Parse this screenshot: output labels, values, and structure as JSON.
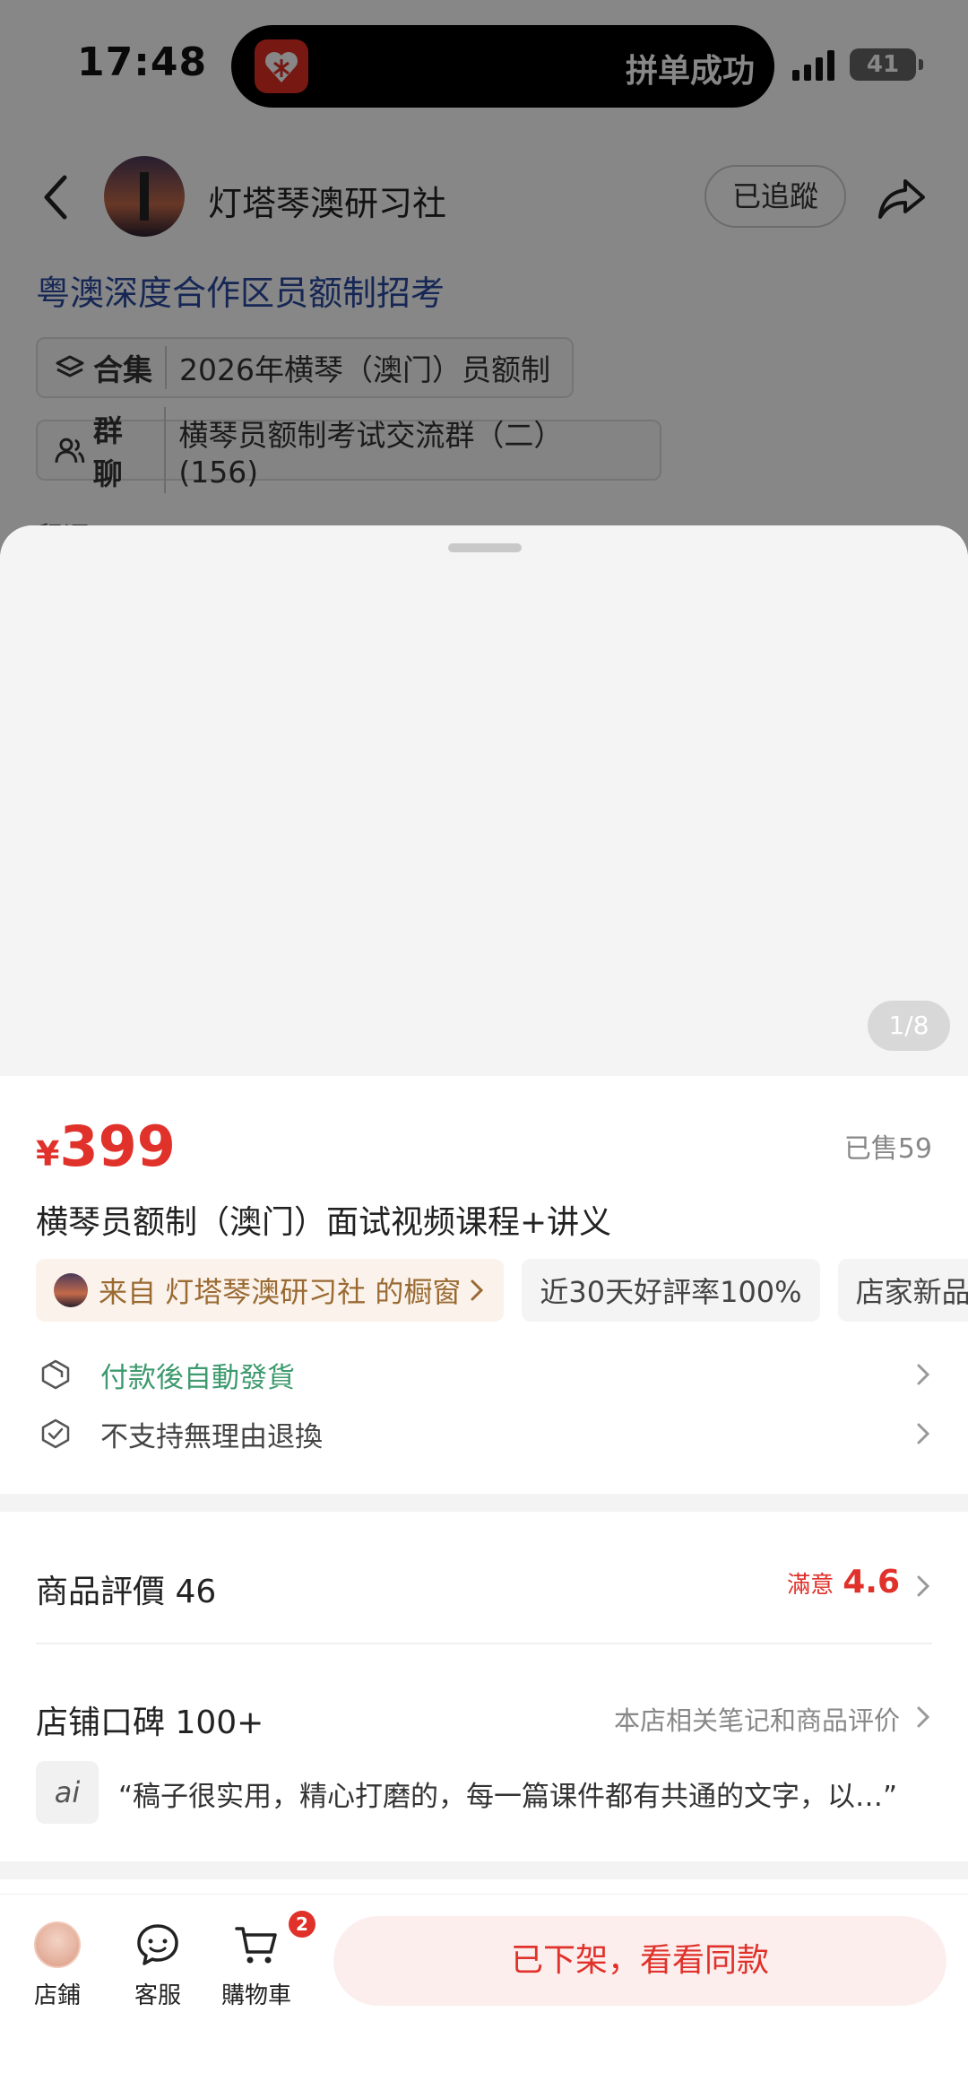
{
  "status_bar": {
    "time": "17:48",
    "island_text": "拼单成功",
    "battery": "41"
  },
  "header": {
    "shop_name": "灯塔琴澳研习社",
    "follow_label": "已追蹤"
  },
  "post": {
    "title": "粤澳深度合作区员额制招考",
    "collection_label": "合集",
    "collection_value": "2026年横琴（澳门）员额制",
    "group_label": "群聊",
    "group_value": "横琴员额制考试交流群（二）(156)",
    "peek_text": "留评"
  },
  "product": {
    "gallery_counter": "1/8",
    "price_symbol": "¥",
    "price": "399",
    "sold": "已售59",
    "title": "横琴员额制（澳门）面试视频课程+讲义",
    "chips": {
      "source": "来自 灯塔琴澳研习社 的橱窗",
      "rating": "近30天好評率100%",
      "new": "店家新品發布"
    },
    "delivery": "付款後自動發貨",
    "return_policy": "不支持無理由退換"
  },
  "reviews": {
    "title": "商品評價 46",
    "satisfaction_label": "滿意",
    "score": "4.6"
  },
  "reputation": {
    "title": "店铺口碑 100+",
    "subtitle": "本店相关笔记和商品评价",
    "ai_badge": "ai",
    "quote": "“稿子很实用，精心打磨的，每一篇课件都有共通的文字，以…”"
  },
  "action_bar": {
    "shop_label": "店鋪",
    "service_label": "客服",
    "cart_label": "購物車",
    "cart_count": "2",
    "offshelf_label": "已下架，看看同款"
  },
  "colors": {
    "accent_red": "#e0312a",
    "delivery_green": "#3d9a6e",
    "link_blue": "#2a4aa0",
    "source_chip_text": "#9a6a32"
  }
}
